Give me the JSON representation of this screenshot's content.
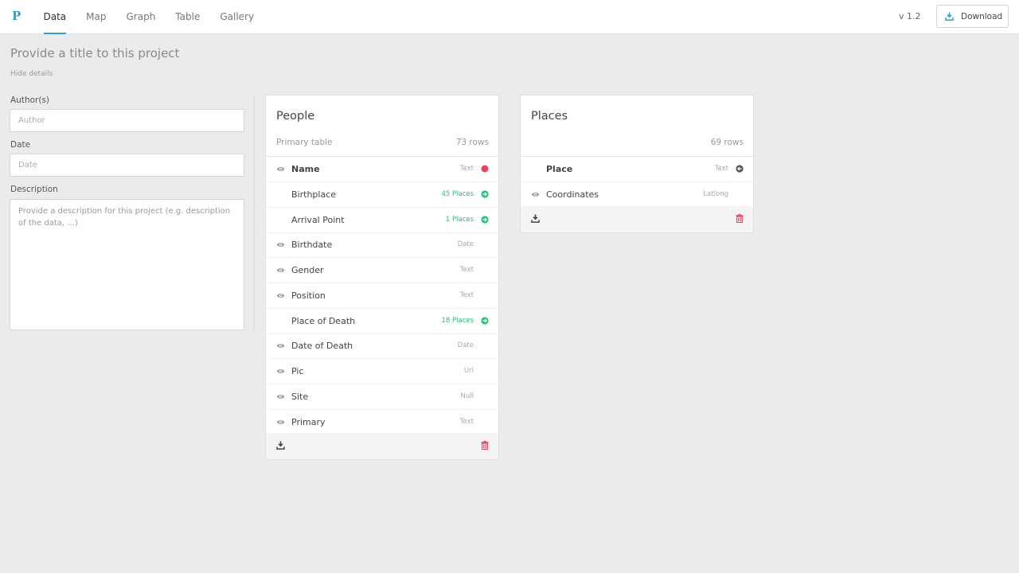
{
  "navbar": {
    "logo": "P",
    "tabs": [
      {
        "label": "Data",
        "active": true
      },
      {
        "label": "Map",
        "active": false
      },
      {
        "label": "Graph",
        "active": false
      },
      {
        "label": "Table",
        "active": false
      },
      {
        "label": "Gallery",
        "active": false
      }
    ],
    "version": "v 1.2",
    "download_label": "Download"
  },
  "details": {
    "title_placeholder": "Provide a title to this project",
    "hide_details": "Hide details",
    "author_label": "Author(s)",
    "author_placeholder": "Author",
    "date_label": "Date",
    "date_placeholder": "Date",
    "description_label": "Description",
    "description_placeholder": "Provide a description for this project (e.g. description of the data, ...)"
  },
  "tables": [
    {
      "title": "People",
      "subtitle": "Primary table",
      "rows_count": "73 rows",
      "fields": [
        {
          "name": "Name",
          "type": "Text",
          "eye": true,
          "bold": true,
          "right_icon": "red-dot-icon"
        },
        {
          "name": "Birthplace",
          "type": "45 Places",
          "eye": false,
          "link": true,
          "right_icon": "arrow-right-circle-icon"
        },
        {
          "name": "Arrival Point",
          "type": "1 Places",
          "eye": false,
          "link": true,
          "right_icon": "arrow-right-circle-icon"
        },
        {
          "name": "Birthdate",
          "type": "Date",
          "eye": true
        },
        {
          "name": "Gender",
          "type": "Text",
          "eye": true
        },
        {
          "name": "Position",
          "type": "Text",
          "eye": true
        },
        {
          "name": "Place of Death",
          "type": "18 Places",
          "eye": false,
          "link": true,
          "right_icon": "arrow-right-circle-icon"
        },
        {
          "name": "Date of Death",
          "type": "Date",
          "eye": true
        },
        {
          "name": "Pic",
          "type": "Url",
          "eye": true
        },
        {
          "name": "Site",
          "type": "Null",
          "eye": true
        },
        {
          "name": "Primary",
          "type": "Text",
          "eye": true
        }
      ]
    },
    {
      "title": "Places",
      "subtitle": "",
      "rows_count": "69 rows",
      "fields": [
        {
          "name": "Place",
          "type": "Text",
          "eye": false,
          "bold": true,
          "right_icon": "arrow-left-circle-icon"
        },
        {
          "name": "Coordinates",
          "type": "Latlong",
          "eye": true
        }
      ]
    }
  ],
  "colors": {
    "accent": "#2b9fdc",
    "link_green": "#22c37a",
    "danger_red": "#e8445a"
  }
}
